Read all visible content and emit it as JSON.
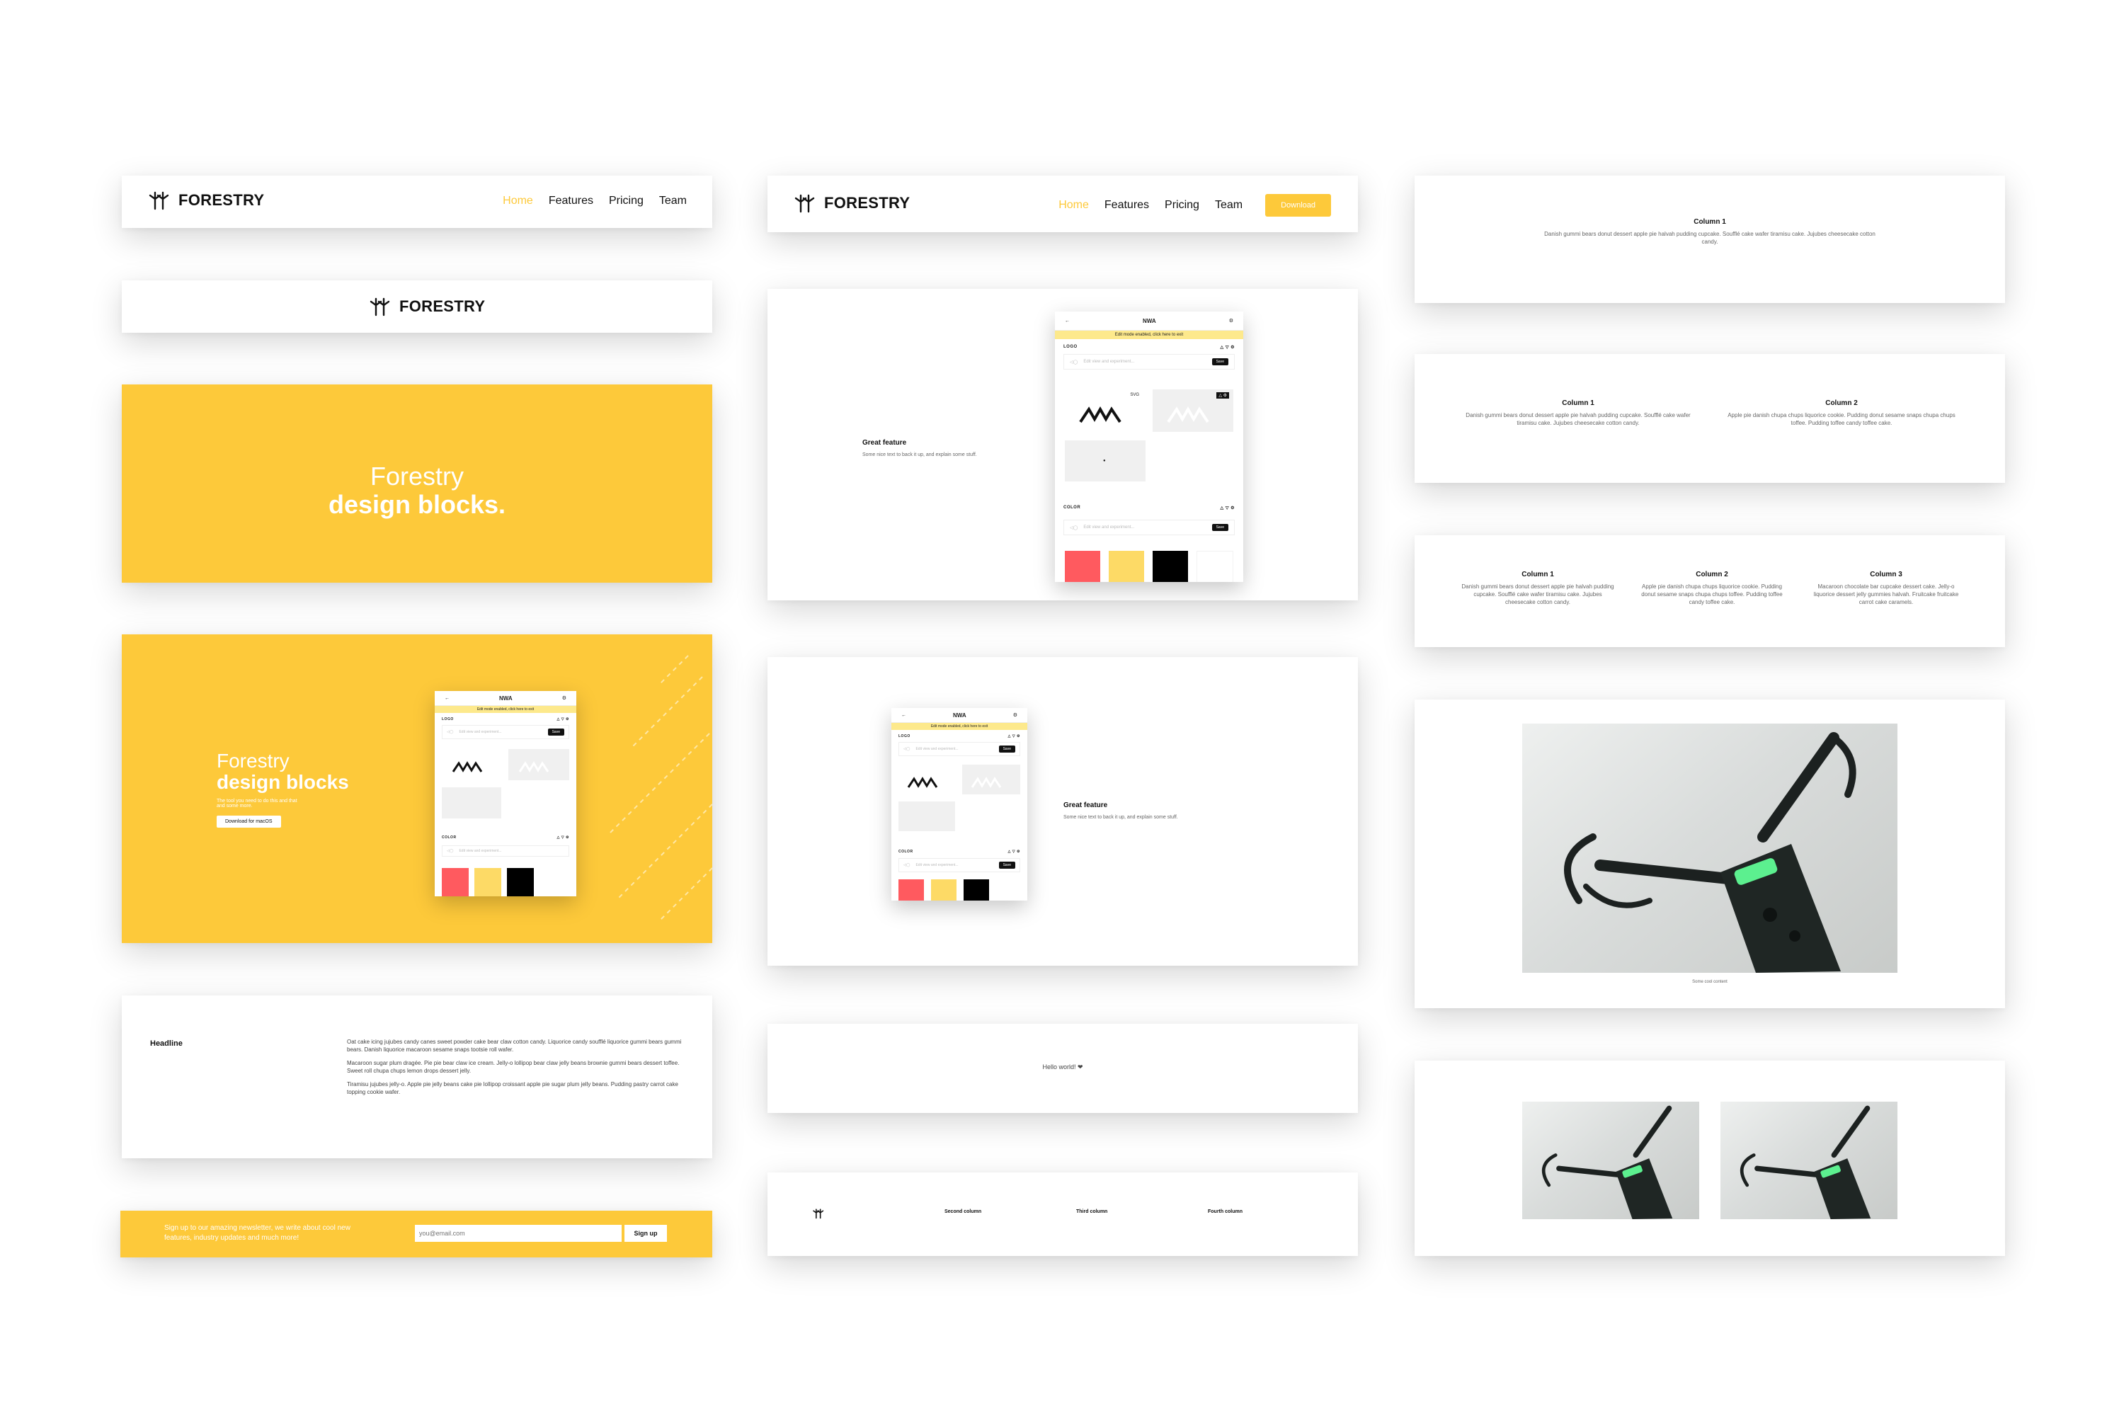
{
  "brand": {
    "name": "FORESTRY"
  },
  "nav": {
    "home": "Home",
    "features": "Features",
    "pricing": "Pricing",
    "team": "Team",
    "download": "Download"
  },
  "hero": {
    "line1": "Forestry",
    "line2": "design blocks."
  },
  "hero2": {
    "line1": "Forestry",
    "line2": "design blocks",
    "sub1": "The tool you need to do this and that",
    "sub2": "and some more.",
    "button": "Download for macOS"
  },
  "app": {
    "title": "NWA",
    "edit_banner": "Edit mode enabled, click here to exit",
    "logo_section": "LOGO",
    "color_section": "COLOR",
    "placeholder": "Edit view and experiment...",
    "save": "Save",
    "badge": "SVG",
    "logo_text": "NWA",
    "swatches": [
      "#FF5A5F",
      "#FDDA66",
      "#000000",
      "#FFFFFF"
    ]
  },
  "feature": {
    "title": "Great feature",
    "text": "Some nice text to back it up, and explain some stuff."
  },
  "text_block": {
    "headline": "Headline",
    "p1": "Oat cake icing jujubes candy canes sweet powder cake bear claw cotton candy. Liquorice candy soufflé liquorice gummi bears gummi bears. Danish liquorice macaroon sesame snaps tootsie roll wafer.",
    "p2": "Macaroon sugar plum dragée. Pie pie bear claw ice cream. Jelly-o lollipop bear claw jelly beans brownie gummi bears dessert toffee. Sweet roll chupa chups lemon drops dessert jelly.",
    "p3": "Tiramisu jujubes jelly-o. Apple pie jelly beans cake pie lollipop croissant apple pie sugar plum jelly beans. Pudding pastry carrot cake topping cookie wafer."
  },
  "newsletter": {
    "text1": "Sign up to our amazing newsletter, we write about cool new",
    "text2": "features, industry updates and much more!",
    "placeholder": "you@email.com",
    "button": "Sign up"
  },
  "hello": {
    "text": "Hello world! ❤"
  },
  "footer": {
    "col2": "Second column",
    "col3": "Third column",
    "col4": "Fourth column"
  },
  "columns": {
    "c1": {
      "title": "Column 1",
      "text": "Danish gummi bears donut dessert apple pie halvah pudding cupcake. Soufflé cake wafer tiramisu cake. Jujubes cheesecake cotton candy."
    },
    "c2": {
      "title": "Column 2",
      "text": "Apple pie danish chupa chups liquorice cookie. Pudding donut sesame snaps chupa chups toffee. Pudding toffee candy toffee cake."
    },
    "c3": {
      "title": "Column 3",
      "text": "Macaroon chocolate bar cupcake dessert cake. Jelly-o liquorice dessert jelly gummies halvah. Fruitcake fruitcake carrot cake caramels."
    }
  },
  "image_caption": "Some cool content"
}
